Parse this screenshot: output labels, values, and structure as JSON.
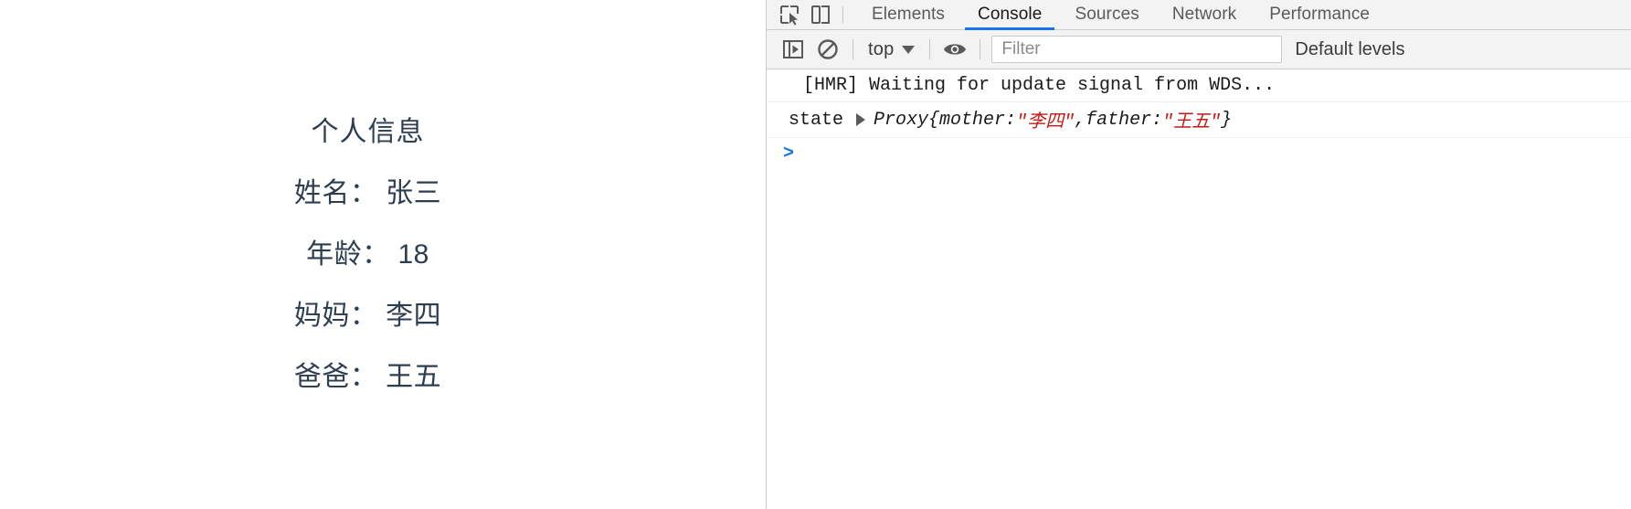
{
  "page": {
    "title": "个人信息",
    "rows": [
      {
        "label": "姓名：",
        "value": "张三"
      },
      {
        "label": "年龄：",
        "value": "18"
      },
      {
        "label": "妈妈：",
        "value": "李四"
      },
      {
        "label": "爸爸：",
        "value": "王五"
      }
    ],
    "line_name": "姓名： 张三",
    "line_age": "年龄： 18",
    "line_mother": "妈妈： 李四",
    "line_father": "爸爸： 王五"
  },
  "devtools": {
    "icons": {
      "inspect": "inspect-element-icon",
      "device": "device-toolbar-icon",
      "sidebar": "console-sidebar-icon",
      "clear": "clear-console-icon",
      "eye": "live-expression-icon"
    },
    "tabs": [
      {
        "label": "Elements",
        "active": false
      },
      {
        "label": "Console",
        "active": true
      },
      {
        "label": "Sources",
        "active": false
      },
      {
        "label": "Network",
        "active": false
      },
      {
        "label": "Performance",
        "active": false
      }
    ],
    "tab_elements": "Elements",
    "tab_console": "Console",
    "tab_sources": "Sources",
    "tab_network": "Network",
    "tab_performance": "Performance",
    "toolbar": {
      "context": "top",
      "filter_placeholder": "Filter",
      "filter_value": "",
      "levels": "Default levels"
    },
    "accent_color": "#1a73e8",
    "string_color": "#c41a16",
    "messages": [
      {
        "type": "log",
        "text": "[HMR] Waiting for update signal from WDS..."
      },
      {
        "type": "object",
        "key": "state",
        "object_name": "Proxy",
        "open_brace": "{",
        "prop1_key": "mother: ",
        "prop1_value": "\"李四\"",
        "comma": ", ",
        "prop2_key": "father: ",
        "prop2_value": "\"王五\"",
        "close_brace": "}"
      }
    ],
    "msg_hmr": "[HMR] Waiting for update signal from WDS...",
    "state_label": "state",
    "state_obj": "Proxy",
    "state_brace_open": " {",
    "state_k1": "mother: ",
    "state_v1": "\"李四\"",
    "state_comma": ", ",
    "state_k2": "father: ",
    "state_v2": "\"王五\"",
    "state_brace_close": "}",
    "prompt": ">"
  }
}
